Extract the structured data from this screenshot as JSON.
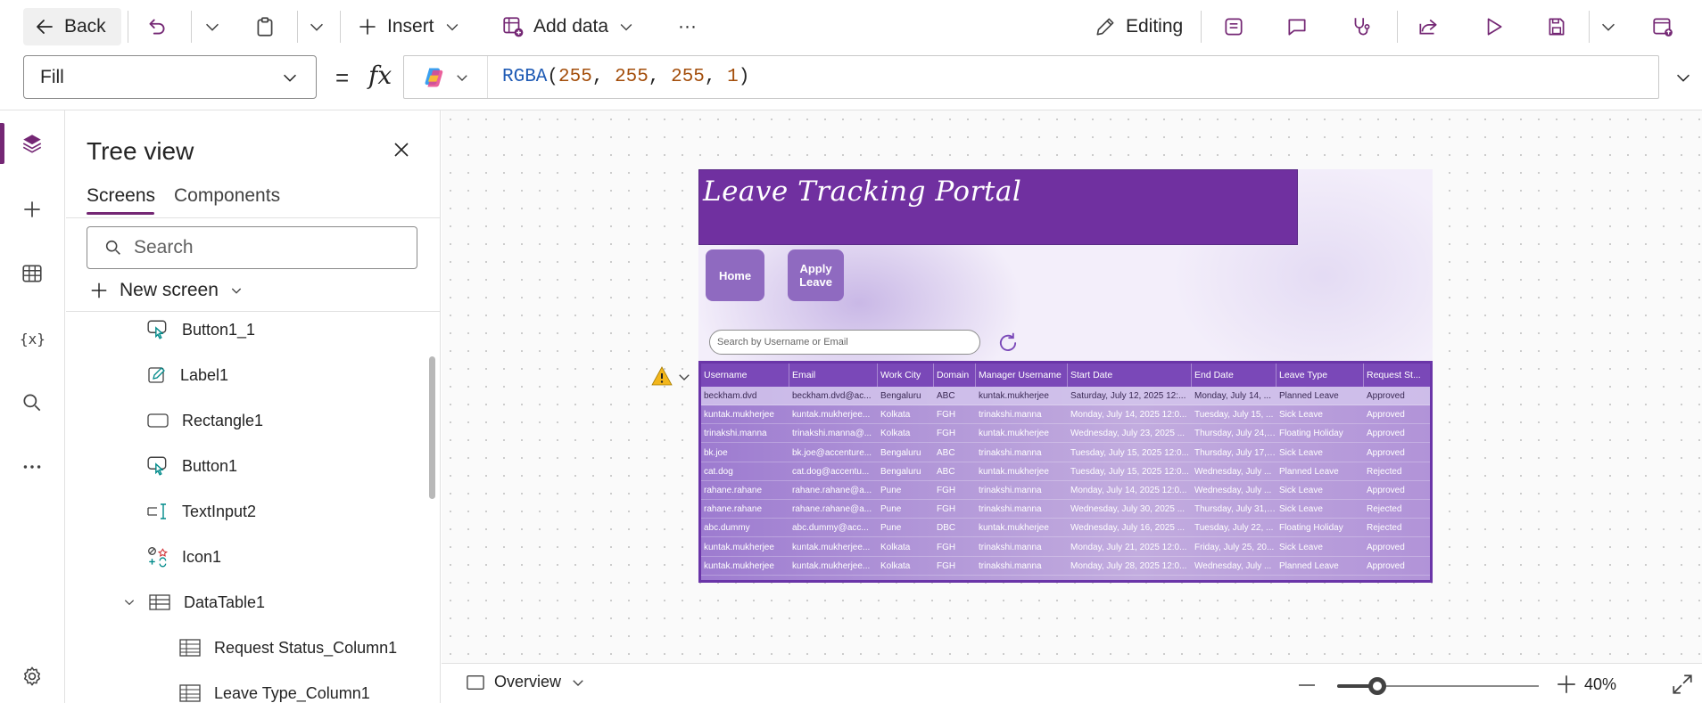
{
  "toolbar": {
    "back_label": "Back",
    "insert_label": "Insert",
    "add_data_label": "Add data",
    "more_label": "···",
    "editing_label": "Editing"
  },
  "formula_bar": {
    "property": "Fill",
    "equals": "=",
    "fx": "fx",
    "formula_fn": "RGBA",
    "formula_args": [
      "255",
      "255",
      "255",
      "1"
    ]
  },
  "tree_view": {
    "title": "Tree view",
    "tabs": [
      "Screens",
      "Components"
    ],
    "search_placeholder": "Search",
    "new_screen_label": "New screen",
    "nodes": [
      {
        "label": "Button1_1",
        "icon": "button-icon"
      },
      {
        "label": "Label1",
        "icon": "label-icon"
      },
      {
        "label": "Rectangle1",
        "icon": "rectangle-icon"
      },
      {
        "label": "Button1",
        "icon": "button-icon"
      },
      {
        "label": "TextInput2",
        "icon": "text-input-icon"
      },
      {
        "label": "Icon1",
        "icon": "icon-control-icon"
      },
      {
        "label": "DataTable1",
        "icon": "data-table-icon"
      },
      {
        "label": "Request Status_Column1",
        "icon": "column-icon"
      },
      {
        "label": "Leave Type_Column1",
        "icon": "column-icon"
      }
    ]
  },
  "app_screen": {
    "title": "Leave Tracking Portal",
    "home_button": "Home",
    "apply_button_line1": "Apply",
    "apply_button_line2": "Leave",
    "search_placeholder": "Search by Username or Email",
    "columns": [
      "Username",
      "Email",
      "Work City",
      "Domain",
      "Manager Username",
      "Start Date",
      "End Date",
      "Leave Type",
      "Request St..."
    ],
    "rows": [
      [
        "beckham.dvd",
        "beckham.dvd@ac...",
        "Bengaluru",
        "ABC",
        "kuntak.mukherjee",
        "Saturday, July 12, 2025 12:...",
        "Monday, July 14, ...",
        "Planned Leave",
        "Approved"
      ],
      [
        "kuntak.mukherjee",
        "kuntak.mukherjee...",
        "Kolkata",
        "FGH",
        "trinakshi.manna",
        "Monday, July 14, 2025 12:0...",
        "Tuesday, July 15, ...",
        "Sick Leave",
        "Approved"
      ],
      [
        "trinakshi.manna",
        "trinakshi.manna@...",
        "Kolkata",
        "FGH",
        "kuntak.mukherjee",
        "Wednesday, July 23, 2025 ...",
        "Thursday, July 24, ...",
        "Floating Holiday",
        "Approved"
      ],
      [
        "bk.joe",
        "bk.joe@accenture...",
        "Bengaluru",
        "ABC",
        "trinakshi.manna",
        "Tuesday, July 15, 2025 12:0...",
        "Thursday, July 17, ...",
        "Sick Leave",
        "Approved"
      ],
      [
        "cat.dog",
        "cat.dog@accentu...",
        "Bengaluru",
        "ABC",
        "kuntak.mukherjee",
        "Tuesday, July 15, 2025 12:0...",
        "Wednesday, July ...",
        "Planned Leave",
        "Rejected"
      ],
      [
        "rahane.rahane",
        "rahane.rahane@a...",
        "Pune",
        "FGH",
        "trinakshi.manna",
        "Monday, July 14, 2025 12:0...",
        "Wednesday, July ...",
        "Sick Leave",
        "Approved"
      ],
      [
        "rahane.rahane",
        "rahane.rahane@a...",
        "Pune",
        "FGH",
        "trinakshi.manna",
        "Wednesday, July 30, 2025 ...",
        "Thursday, July 31, ...",
        "Sick Leave",
        "Rejected"
      ],
      [
        "abc.dummy",
        "abc.dummy@acc...",
        "Pune",
        "DBC",
        "kuntak.mukherjee",
        "Wednesday, July 16, 2025 ...",
        "Tuesday, July 22, ...",
        "Floating Holiday",
        "Rejected"
      ],
      [
        "kuntak.mukherjee",
        "kuntak.mukherjee...",
        "Kolkata",
        "FGH",
        "trinakshi.manna",
        "Monday, July 21, 2025 12:0...",
        "Friday, July 25, 20...",
        "Sick Leave",
        "Approved"
      ],
      [
        "kuntak.mukherjee",
        "kuntak.mukherjee...",
        "Kolkata",
        "FGH",
        "trinakshi.manna",
        "Monday, July 28, 2025 12:0...",
        "Wednesday, July ...",
        "Planned Leave",
        "Approved"
      ]
    ]
  },
  "bottom_bar": {
    "overview_label": "Overview",
    "zoom_value": "40%",
    "zoom_fraction": 0.4
  },
  "colors": {
    "accent": "#742774",
    "app_header": "#7030a0",
    "table_header": "#7a48b8",
    "nav_button": "#8f6ac0"
  }
}
